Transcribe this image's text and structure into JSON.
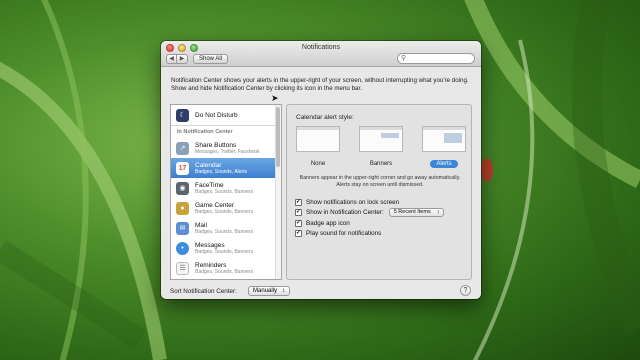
{
  "window": {
    "title": "Notifications"
  },
  "toolbar": {
    "back_icon": "◀",
    "forward_icon": "▶",
    "show_all_label": "Show All",
    "search_placeholder": ""
  },
  "intro_text": "Notification Center shows your alerts in the upper-right of your screen, without interrupting what you're doing. Show and hide Notification Center by clicking its icon in the menu bar.",
  "sidebar": {
    "dnd_label": "Do Not Disturb",
    "section_label": "In Notification Center",
    "items": [
      {
        "name": "Share Buttons",
        "sub": "Messages, Twitter, Facebook",
        "icon": "share-icon",
        "color": "#8aa0b8"
      },
      {
        "name": "Calendar",
        "sub": "Badges, Sounds, Alerts",
        "icon": "calendar-icon",
        "color": "#d9534f"
      },
      {
        "name": "FaceTime",
        "sub": "Badges, Sounds, Banners",
        "icon": "facetime-icon",
        "color": "#5b6470"
      },
      {
        "name": "Game Center",
        "sub": "Badges, Sounds, Banners",
        "icon": "game-center-icon",
        "color": "#c8a23b"
      },
      {
        "name": "Mail",
        "sub": "Badges, Sounds, Banners",
        "icon": "mail-icon",
        "color": "#5c8fd6"
      },
      {
        "name": "Messages",
        "sub": "Badges, Sounds, Banners",
        "icon": "messages-icon",
        "color": "#3b8de0"
      },
      {
        "name": "Reminders",
        "sub": "Badges, Sounds, Banners",
        "icon": "reminders-icon",
        "color": "#e8e8e8"
      }
    ],
    "selected_index": 1
  },
  "panel": {
    "style_label": "Calendar alert style:",
    "styles": [
      "None",
      "Banners",
      "Alerts"
    ],
    "selected_style": "Alerts",
    "description": "Banners appear in the upper-right corner and go away automatically. Alerts stay on screen until dismissed.",
    "checks": [
      {
        "label": "Show notifications on lock screen",
        "checked": true
      },
      {
        "label": "Show in Notification Center:",
        "checked": true,
        "popup": "5 Recent Items"
      },
      {
        "label": "Badge app icon",
        "checked": true
      },
      {
        "label": "Play sound for notifications",
        "checked": true
      }
    ]
  },
  "footer": {
    "sort_label": "Sort Notification Center:",
    "sort_value": "Manually",
    "help": "?"
  },
  "popup_arrows": "↕"
}
